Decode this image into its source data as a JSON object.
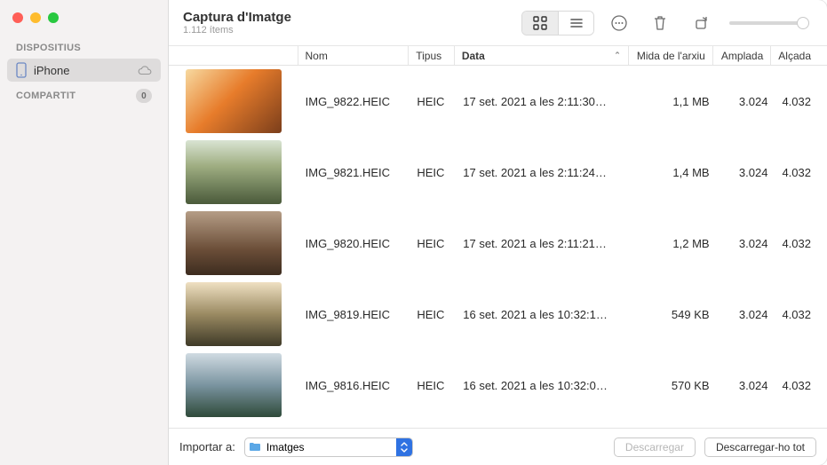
{
  "header": {
    "title": "Captura d'Imatge",
    "subtitle": "1.112 ítems"
  },
  "sidebar": {
    "sections": [
      {
        "label": "DISPOSITIUS",
        "badge": null
      },
      {
        "label": "COMPARTIT",
        "badge": "0"
      }
    ],
    "device": {
      "label": "iPhone",
      "icon": "phone-icon",
      "cloud": true,
      "selected": true
    }
  },
  "toolbar": {
    "view_grid": "grid-icon",
    "view_list": "list-icon",
    "more": "more-icon",
    "trash": "trash-icon",
    "rotate": "rotate-icon",
    "slider_value": 100
  },
  "columns": {
    "name": "Nom",
    "type": "Tipus",
    "date": "Data",
    "size": "Mida de l'arxiu",
    "width": "Amplada",
    "height": "Alçada",
    "sorted": "date"
  },
  "rows": [
    {
      "name": "IMG_9822.HEIC",
      "type": "HEIC",
      "date": "17 set. 2021 a les 2:11:30…",
      "size": "1,1 MB",
      "width": "3.024",
      "height": "4.032"
    },
    {
      "name": "IMG_9821.HEIC",
      "type": "HEIC",
      "date": "17 set. 2021 a les 2:11:24…",
      "size": "1,4 MB",
      "width": "3.024",
      "height": "4.032"
    },
    {
      "name": "IMG_9820.HEIC",
      "type": "HEIC",
      "date": "17 set. 2021 a les 2:11:21…",
      "size": "1,2 MB",
      "width": "3.024",
      "height": "4.032"
    },
    {
      "name": "IMG_9819.HEIC",
      "type": "HEIC",
      "date": "16 set. 2021 a les 10:32:1…",
      "size": "549 KB",
      "width": "3.024",
      "height": "4.032"
    },
    {
      "name": "IMG_9816.HEIC",
      "type": "HEIC",
      "date": "16 set. 2021 a les 10:32:0…",
      "size": "570 KB",
      "width": "3.024",
      "height": "4.032"
    }
  ],
  "footer": {
    "import_label": "Importar a:",
    "destination": "Imatges",
    "download": "Descarregar",
    "download_all": "Descarregar-ho tot"
  }
}
